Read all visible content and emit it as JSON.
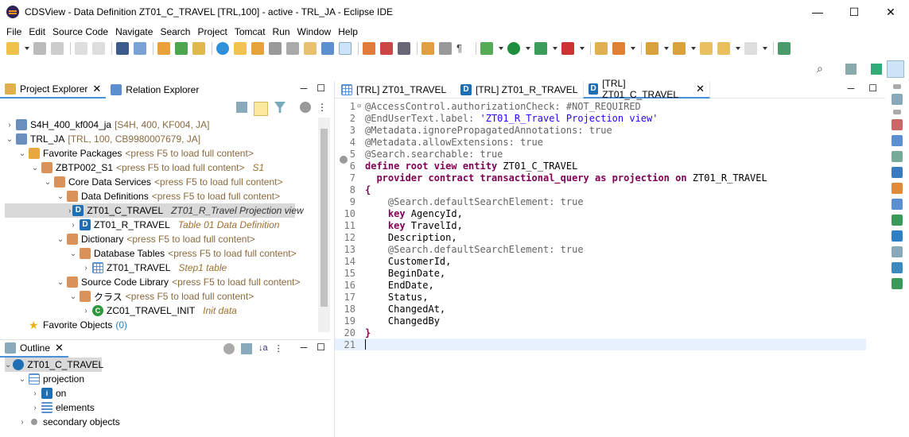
{
  "window": {
    "title": "CDSView - Data Definition ZT01_C_TRAVEL [TRL,100] - active - TRL_JA - Eclipse IDE",
    "minimize": "—",
    "maximize": "☐",
    "close": "✕"
  },
  "menu": [
    "File",
    "Edit",
    "Source Code",
    "Navigate",
    "Search",
    "Project",
    "Tomcat",
    "Run",
    "Window",
    "Help"
  ],
  "left_tabs": {
    "project_explorer": "Project Explorer",
    "relation_explorer": "Relation Explorer"
  },
  "tree": {
    "r1_name": "S4H_400_kf004_ja",
    "r1_dec": "[S4H, 400, KF004, JA]",
    "r2_name": "TRL_JA",
    "r2_dec": "[TRL, 100, CB9980007679, JA]",
    "fav_pkg": "Favorite Packages",
    "fav_pkg_dec": "<press F5 to load full content>",
    "pkg": "ZBTP002_S1",
    "pkg_dec": "<press F5 to load full content>",
    "pkg_desc": "S1",
    "cds": "Core Data Services",
    "cds_dec": "<press F5 to load full content>",
    "dd": "Data Definitions",
    "dd_dec": "<press F5 to load full content>",
    "ddl1": "ZT01_C_TRAVEL",
    "ddl1_desc": "ZT01_R_Travel Projection view",
    "ddl2": "ZT01_R_TRAVEL",
    "ddl2_desc": "Table 01 Data Definition",
    "dict": "Dictionary",
    "dict_dec": "<press F5 to load full content>",
    "dbt": "Database Tables",
    "dbt_dec": "<press F5 to load full content>",
    "tab1": "ZT01_TRAVEL",
    "tab1_desc": "Step1 table",
    "scl": "Source Code Library",
    "scl_dec": "<press F5 to load full content>",
    "cls": "クラス",
    "cls_dec": "<press F5 to load full content>",
    "cls1": "ZC01_TRAVEL_INIT",
    "cls1_desc": "Init data",
    "fav_obj": "Favorite Objects",
    "fav_obj_count": "(0)"
  },
  "outline": {
    "tab": "Outline",
    "root": "ZT01_C_TRAVEL",
    "projection": "projection",
    "on": "on",
    "elements": "elements",
    "secondary": "secondary objects"
  },
  "editor_tabs": [
    {
      "label": "[TRL] ZT01_TRAVEL"
    },
    {
      "label": "[TRL] ZT01_R_TRAVEL"
    },
    {
      "label": "[TRL] ZT01_C_TRAVEL"
    }
  ],
  "code": {
    "l1": "@AccessControl.authorizationCheck: #NOT_REQUIRED",
    "l2a": "@EndUserText.label: ",
    "l2b": "'ZT01_R_Travel Projection view'",
    "l3a": "@Metadata.ignorePropagatedAnnotations: ",
    "l3b": "true",
    "l4a": "@Metadata.allowExtensions: ",
    "l4b": "true",
    "l5a": "@Search.searchable: ",
    "l5b": "true",
    "l6a": "define root view entity",
    "l6b": " ZT01_C_TRAVEL",
    "l7a": "  provider contract transactional_query as projection on",
    "l7b": " ZT01_R_TRAVEL",
    "l8": "{",
    "l9a": "    @Search.defaultSearchElement: ",
    "l9b": "true",
    "l10a": "    key",
    "l10b": " AgencyId,",
    "l11a": "    key",
    "l11b": " TravelId,",
    "l12": "    Description,",
    "l13a": "    @Search.defaultSearchElement: ",
    "l13b": "true",
    "l14": "    CustomerId,",
    "l15": "    BeginDate,",
    "l16": "    EndDate,",
    "l17": "    Status,",
    "l18": "    ChangedAt,",
    "l19": "    ChangedBy",
    "l20": "}",
    "l21": ""
  },
  "line_numbers": [
    "1",
    "2",
    "3",
    "4",
    "5",
    "6",
    "7",
    "8",
    "9",
    "10",
    "11",
    "12",
    "13",
    "14",
    "15",
    "16",
    "17",
    "18",
    "19",
    "20",
    "21"
  ]
}
